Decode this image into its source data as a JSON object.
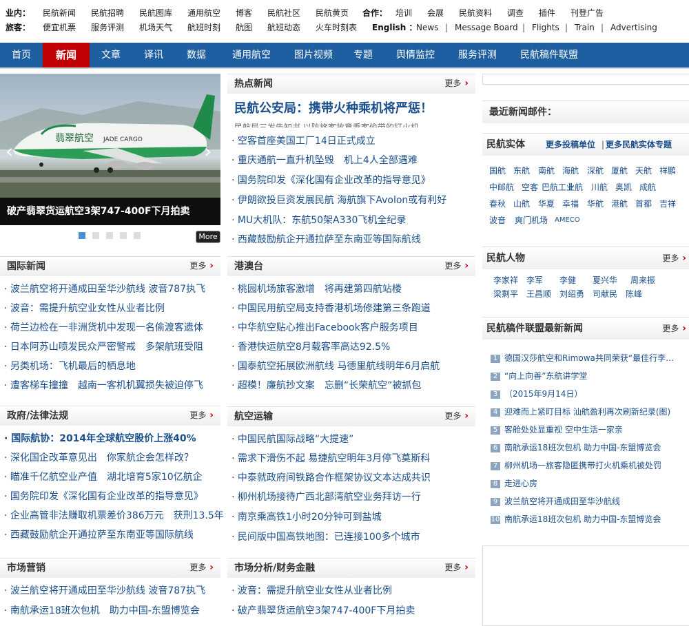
{
  "top_links": {
    "industry_label": "业内：",
    "industry": [
      "民航新闻",
      "民航招聘",
      "民航图库",
      "通用航空",
      "博客",
      "民航社区",
      "民航黄页"
    ],
    "cooperation_label": "合作：",
    "cooperation": [
      "培训",
      "会展",
      "民航资料",
      "调查",
      "插件",
      "刊登广告"
    ],
    "passenger_label": "旅客：",
    "passenger": [
      "便宜机票",
      "服务评测",
      "机场天气",
      "航班时刻",
      "航图",
      "航班动态",
      "火车时刻表"
    ],
    "english_label": "English ：",
    "english": [
      "News",
      "Message Board",
      "Flights",
      "Train",
      "Advertising"
    ],
    "separator": "|"
  },
  "nav": [
    "首页",
    "新闻",
    "文章",
    "译讯",
    "数据",
    "通用航空",
    "图片视频",
    "专题",
    "舆情监控",
    "服务评测",
    "民航稿件联盟"
  ],
  "slider": {
    "caption": "破产翡翠货运航空3架747-400F下月拍卖",
    "prev": "‹",
    "next": "›",
    "more": "More",
    "dot_count": 5,
    "active_dot": 0,
    "plane_text": "翡翠航空",
    "plane_brand": "JADE CARGO"
  },
  "hot_news": {
    "title": "热点新闻",
    "more": "更多",
    "headline": "民航公安局：携带火种乘机将严惩！",
    "summary": "民航局三发告知书 以防旅客故意乘客偷带的打火机",
    "items": [
      "空客首座美国工厂14日正式成立",
      "重庆通航一直升机坠毁　机上4人全部遇难",
      "国务院印发《深化国有企业改革的指导意见》",
      "伊朗欲投巨资发展民航 海航旗下Avolon或有利好",
      "MU大机队：东航50架A330飞机全纪录",
      "西藏鼓励航企开通拉萨至东南亚等国际航线"
    ]
  },
  "international": {
    "title": "国际新闻",
    "more": "更多",
    "items": [
      "波兰航空将开通成田至华沙航线 波音787执飞",
      "波音：需提升航空业女性从业者比例",
      "荷兰边检在一非洲货机中发现一名偷渡客遗体",
      "日本阿苏山喷发民众严密警戒　多架航班受阻",
      "另类机场：飞机最后的栖息地",
      "遭客梯车撞撞　越南一客机机翼损失被迫停飞"
    ]
  },
  "hkmacau": {
    "title": "港澳台",
    "more": "更多",
    "items": [
      "桃园机场旅客激增　将再建第四航站楼",
      "中国民用航空局支持香港机场修建第三条跑道",
      "中华航空贴心推出Facebook客户服务项目",
      "香港快运航空8月载客率高达92.5%",
      "国泰航空拓展欧洲航线 马德里航线明年6月启航",
      "超模！廉航抄文案　忘删“长荣航空”被抓包"
    ]
  },
  "government": {
    "title": "政府/法律法规",
    "more": "更多",
    "items": [
      "国际航协：2014年全球航空股价上涨40%",
      "深化国企改革意见出　你家航企会怎样改？",
      "瞄准千亿航空业产值　湖北培育5家10亿航企",
      "国务院印发《深化国有企业改革的指导意见》",
      "企业高管非法赚取机票差价386万元　获刑13.5年",
      "西藏鼓励航企开通拉萨至东南亚等国际航线"
    ]
  },
  "air_transport": {
    "title": "航空运输",
    "more": "更多",
    "items": [
      "中国民航国际战略“大提速”",
      "需求下滑伤不起 易捷航空明年3月停飞莫斯科",
      "中泰就政府间铁路合作框架协议文本达成共识",
      "柳州机场接待广西北部湾航空业务拜访一行",
      "南京乘高铁1小时20分钟可到盐城",
      "民间版中国高铁地图：已连接100多个城市"
    ]
  },
  "marketing": {
    "title": "市场营销",
    "more": "更多",
    "items": [
      "波兰航空将开通成田至华沙航线 波音787执飞",
      "南航承运18班次包机　助力中国-东盟博览会"
    ]
  },
  "market_analysis": {
    "title": "市场分析/财务金融",
    "more": "更多",
    "items": [
      "波音：需提升航空业女性从业者比例",
      "破产翡翠货运航空3架747-400F下月拍卖"
    ]
  },
  "right": {
    "latest_mail": "最近新闻邮件：",
    "entities_title": "民航实体",
    "entities_more1": "更多投稿单位",
    "entities_sep": "|",
    "entities_more2": "更多民航实体专题",
    "entities": [
      "国航",
      "东航",
      "南航",
      "海航",
      "深航",
      "厦航",
      "天航",
      "祥鹏",
      "中邮航",
      "空客",
      "巴航工业",
      "上航",
      "川航",
      "奥凯",
      "成航",
      "春秋",
      "山航",
      "华夏",
      "幸福",
      "华航",
      "港航",
      "首都",
      "吉祥",
      "波音",
      "爽门机场",
      "AMECO"
    ],
    "people_title": "民航人物",
    "people_more": "更多",
    "people": [
      "李家祥",
      "李军",
      "李健",
      "夏兴华",
      "周来振",
      "梁剩平",
      "王昌顺",
      "刘绍勇",
      "司献民",
      "陈峰"
    ],
    "alliance_title": "民航稿件联盟最新新闻",
    "alliance_more": "更多",
    "alliance": [
      "德国汉莎航空和Rimowa共同荣获“最佳行李…",
      "“向上向善”东航讲学堂",
      "（2015年9月14日）",
      "迎难而上紧盯目标 汕航盈利再次刷新纪录(图)",
      "客舱处处显重视 空中生活一家亲",
      "南航承运18班次包机 助力中国-东盟博览会",
      "柳州机场一旅客隐匿携带打火机乘机被处罚",
      "走进心房",
      "波兰航空将开通成田至华沙航线",
      "南航承运18班次包机 助力中国-东盟博览会"
    ]
  }
}
